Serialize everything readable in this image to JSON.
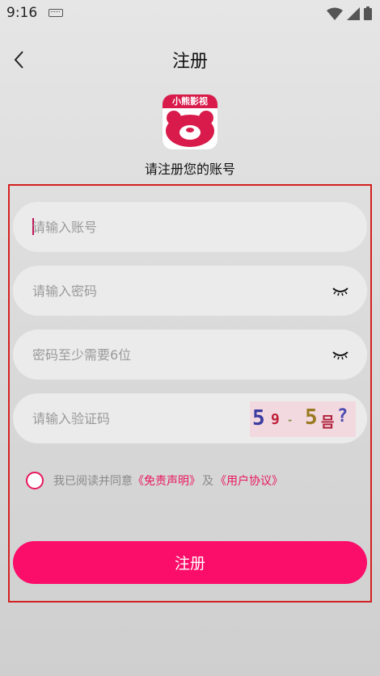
{
  "status": {
    "time": "9:16"
  },
  "header": {
    "title": "注册"
  },
  "logo": {
    "text": "小熊影视"
  },
  "subtitle": "请注册您的账号",
  "form": {
    "account_placeholder": "请输入账号",
    "password_placeholder": "请输入密码",
    "confirm_placeholder": "密码至少需要6位",
    "captcha_placeholder": "请输入验证码",
    "captcha_chars": [
      "5",
      "9",
      "-",
      "5",
      "믐",
      "?"
    ]
  },
  "agreement": {
    "prefix": "我已阅读并同意",
    "disclaimer_link": "《免责声明》",
    "joiner": "及",
    "user_agreement_link": "《用户协议》"
  },
  "submit_label": "注册",
  "colors": {
    "accent": "#fb0d6a",
    "brand": "#d81b4b",
    "frame": "#d32020"
  }
}
